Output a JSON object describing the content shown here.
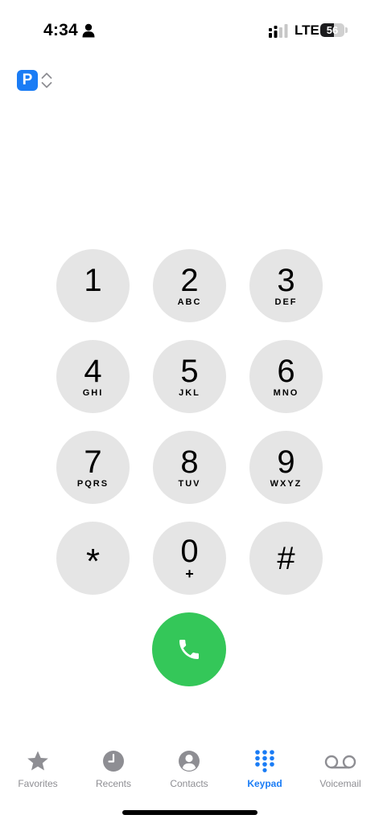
{
  "status_bar": {
    "time": "4:34",
    "network": "LTE",
    "battery_level": "56",
    "battery_percent": 56
  },
  "line_selector": {
    "badge": "P"
  },
  "keypad": {
    "keys": [
      {
        "digit": "1",
        "letters": ""
      },
      {
        "digit": "2",
        "letters": "ABC"
      },
      {
        "digit": "3",
        "letters": "DEF"
      },
      {
        "digit": "4",
        "letters": "GHI"
      },
      {
        "digit": "5",
        "letters": "JKL"
      },
      {
        "digit": "6",
        "letters": "MNO"
      },
      {
        "digit": "7",
        "letters": "PQRS"
      },
      {
        "digit": "8",
        "letters": "TUV"
      },
      {
        "digit": "9",
        "letters": "WXYZ"
      },
      {
        "digit": "*",
        "letters": ""
      },
      {
        "digit": "0",
        "letters": "+"
      },
      {
        "digit": "#",
        "letters": ""
      }
    ],
    "call_icon": "phone-icon"
  },
  "tabs": [
    {
      "label": "Favorites",
      "icon": "star-icon",
      "active": false
    },
    {
      "label": "Recents",
      "icon": "clock-icon",
      "active": false
    },
    {
      "label": "Contacts",
      "icon": "contact-icon",
      "active": false
    },
    {
      "label": "Keypad",
      "icon": "keypad-icon",
      "active": true
    },
    {
      "label": "Voicemail",
      "icon": "voicemail-icon",
      "active": false
    }
  ],
  "colors": {
    "accent": "#1a7cf5",
    "call_green": "#34c759",
    "key_background": "#e5e5e5",
    "inactive_tab": "#8e8e93"
  }
}
